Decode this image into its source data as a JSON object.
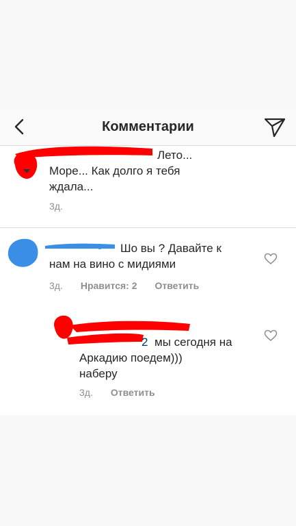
{
  "header": {
    "title": "Комментарии",
    "back_icon": "chevron-left-icon",
    "send_icon": "paper-plane-icon"
  },
  "comments": [
    {
      "text_line1": "Лето...",
      "text_line2": "Море... Как долго я тебя",
      "text_line3": "ждала...",
      "time": "3д."
    },
    {
      "text_line1": "Шо вы ?  Давайте к",
      "text_line2": "нам на вино с мидиями",
      "time": "3д.",
      "likes": "Нравится: 2",
      "reply": "Ответить",
      "heart_icon": "heart-outline-icon"
    },
    {
      "mention_tail": "2",
      "text_line1": "мы сегодня на",
      "text_line2": "Аркадию поедем)))",
      "text_line3": "наберу",
      "time": "3д.",
      "reply": "Ответить",
      "heart_icon": "heart-outline-icon"
    }
  ],
  "colors": {
    "redaction_red": "#ff0000",
    "redaction_blue": "#3a8ee6",
    "text": "#262626",
    "meta": "#8e8e8e",
    "mention": "#003569"
  }
}
